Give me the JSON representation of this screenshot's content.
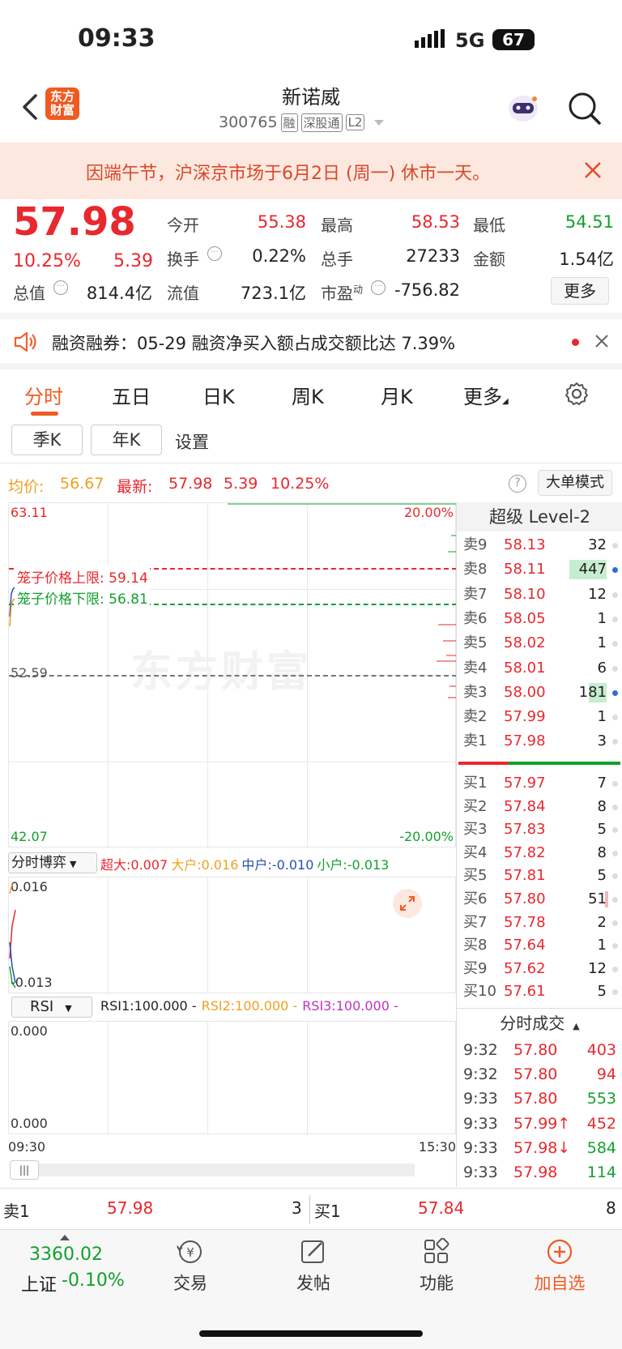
{
  "status_bar": {
    "time": "09:33",
    "network": "5G",
    "battery": "67"
  },
  "header": {
    "logo_text": "东方\n财富",
    "stock_name": "新诺威",
    "stock_code": "300765",
    "tags": [
      "融",
      "深股通",
      "L2"
    ]
  },
  "notice": {
    "text": "因端午节，沪深京市场于6月2日 (周一) 休市一天。"
  },
  "quote": {
    "price": "57.98",
    "change_pct": "10.25%",
    "change": "5.39",
    "stats": [
      {
        "label": "今开",
        "value": "55.38"
      },
      {
        "label": "最高",
        "value": "58.53"
      },
      {
        "label": "最低",
        "value": "54.51"
      },
      {
        "label": "换手",
        "value": "0.22%"
      },
      {
        "label": "总手",
        "value": "27233"
      },
      {
        "label": "金额",
        "value": "1.54亿"
      },
      {
        "label": "总值",
        "value": "814.4亿"
      },
      {
        "label": "流值",
        "value": "723.1亿"
      },
      {
        "label": "市盈",
        "sup": "动",
        "value": "-756.82"
      }
    ],
    "more_label": "更多"
  },
  "news": {
    "text": "融资融券：05-29 融资净买入额占成交额比达 7.39%"
  },
  "tabs": [
    "分时",
    "五日",
    "日K",
    "周K",
    "月K",
    "更多"
  ],
  "subtabs": [
    "季K",
    "年K",
    "设置"
  ],
  "summary": {
    "avg_label": "均价:",
    "avg_value": "56.67",
    "latest_label": "最新:",
    "latest_value": "57.98",
    "latest_change": "5.39",
    "latest_pct": "10.25%",
    "big_order_mode": "大单模式"
  },
  "chart": {
    "y_top": "63.11",
    "y_mid": "52.59",
    "y_bottom": "42.07",
    "pct_top": "20.00%",
    "pct_bottom": "-20.00%",
    "cage_upper": "笼子价格上限: 59.14",
    "cage_lower": "笼子价格下限: 56.81",
    "watermark": "东方财富",
    "game_label": "分时博弈",
    "game_legend": [
      {
        "text": "超大:0.007",
        "color": "#e8282e"
      },
      {
        "text": "大户:0.016",
        "color": "#f0a020"
      },
      {
        "text": "中户:-0.010",
        "color": "#2a4fb0"
      },
      {
        "text": "小户:-0.013",
        "color": "#12a02e"
      }
    ],
    "game_top": "0.016",
    "game_bottom": "-0.013",
    "rsi_label": "RSI",
    "rsi_legend": [
      {
        "text": "RSI1:100.000 -",
        "color": "#222"
      },
      {
        "text": "RSI2:100.000 -",
        "color": "#f0a020"
      },
      {
        "text": "RSI3:100.000 -",
        "color": "#c030c0"
      }
    ],
    "rsi_top": "0.000",
    "rsi_bottom": "0.000",
    "time_start": "09:30",
    "time_end": "15:30"
  },
  "orderbook": {
    "title": "超级 Level-2",
    "asks": [
      {
        "label": "卖9",
        "price": "58.13",
        "vol": "32"
      },
      {
        "label": "卖8",
        "price": "58.11",
        "vol": "447"
      },
      {
        "label": "卖7",
        "price": "58.10",
        "vol": "12"
      },
      {
        "label": "卖6",
        "price": "58.05",
        "vol": "1"
      },
      {
        "label": "卖5",
        "price": "58.02",
        "vol": "1"
      },
      {
        "label": "卖4",
        "price": "58.01",
        "vol": "6"
      },
      {
        "label": "卖3",
        "price": "58.00",
        "vol": "181"
      },
      {
        "label": "卖2",
        "price": "57.99",
        "vol": "1"
      },
      {
        "label": "卖1",
        "price": "57.98",
        "vol": "3"
      }
    ],
    "bids": [
      {
        "label": "买1",
        "price": "57.97",
        "vol": "7"
      },
      {
        "label": "买2",
        "price": "57.84",
        "vol": "8"
      },
      {
        "label": "买3",
        "price": "57.83",
        "vol": "5"
      },
      {
        "label": "买4",
        "price": "57.82",
        "vol": "8"
      },
      {
        "label": "买5",
        "price": "57.81",
        "vol": "5"
      },
      {
        "label": "买6",
        "price": "57.80",
        "vol": "51"
      },
      {
        "label": "买7",
        "price": "57.78",
        "vol": "2"
      },
      {
        "label": "买8",
        "price": "57.64",
        "vol": "1"
      },
      {
        "label": "买9",
        "price": "57.62",
        "vol": "12"
      },
      {
        "label": "买10",
        "price": "57.61",
        "vol": "5"
      }
    ],
    "ticks_title": "分时成交",
    "ticks": [
      {
        "time": "9:32",
        "price": "57.80",
        "vol": "403",
        "dir": "red"
      },
      {
        "time": "9:32",
        "price": "57.80",
        "vol": "94",
        "dir": "red"
      },
      {
        "time": "9:33",
        "price": "57.80",
        "vol": "553",
        "dir": "green"
      },
      {
        "time": "9:33",
        "price": "57.99↑",
        "vol": "452",
        "dir": "red"
      },
      {
        "time": "9:33",
        "price": "57.98↓",
        "vol": "584",
        "dir": "green"
      },
      {
        "time": "9:33",
        "price": "57.98",
        "vol": "114",
        "dir": "green"
      }
    ]
  },
  "bottom_row": {
    "sell_label": "卖1",
    "sell_price": "57.98",
    "sell_vol": "3",
    "buy_label": "买1",
    "buy_price": "57.84",
    "buy_vol": "8"
  },
  "tabbar": {
    "index_value": "3360.02",
    "index_name": "上证",
    "index_change": "-0.10%",
    "items": [
      "交易",
      "发帖",
      "功能",
      "加自选"
    ]
  }
}
